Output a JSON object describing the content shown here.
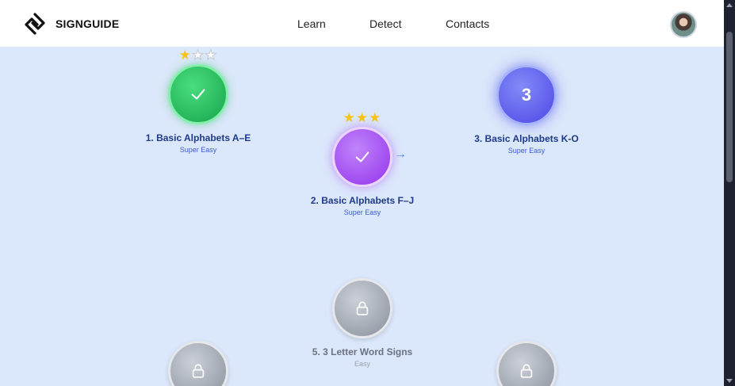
{
  "navbar": {
    "brand": "SIGNGUIDE",
    "links": [
      "Learn",
      "Detect",
      "Contacts"
    ],
    "avatar_icon": "user-avatar"
  },
  "levels": [
    {
      "title": "1. Basic Alphabets A–E",
      "difficulty": "Super Easy",
      "status": "completed",
      "stars": 1,
      "max_stars": 3
    },
    {
      "title": "2. Basic Alphabets F–J",
      "difficulty": "Super Easy",
      "status": "completed",
      "stars": 3,
      "max_stars": 3
    },
    {
      "title": "3. Basic Alphabets K-O",
      "difficulty": "Super Easy",
      "status": "current",
      "number": "3"
    },
    {
      "title": "5. 3 Letter Word Signs",
      "difficulty": "Easy",
      "status": "locked"
    },
    {
      "status": "locked"
    },
    {
      "status": "locked"
    }
  ],
  "colors": {
    "background": "#dbe7fa",
    "completed_green": "#22c55e",
    "completed_purple": "#a855f7",
    "current_indigo": "#6366f1",
    "locked_gray": "#9ca3af",
    "star": "#f5c518",
    "title": "#1e3a8a"
  }
}
